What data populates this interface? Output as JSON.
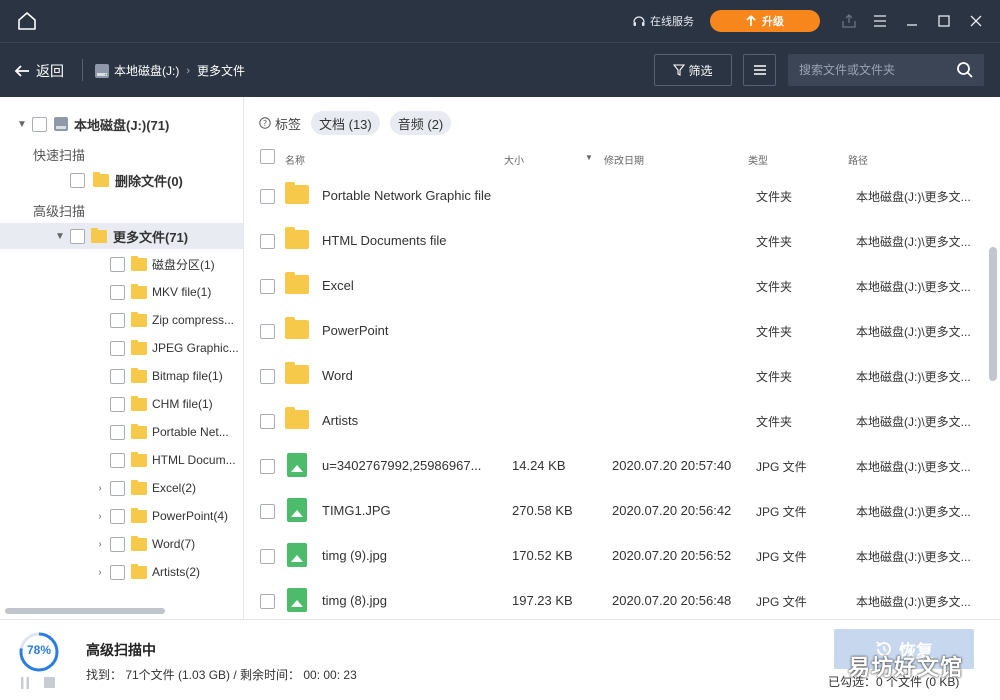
{
  "titlebar": {
    "service_label": "在线服务",
    "upgrade_label": "升级"
  },
  "toolbar": {
    "back_label": "返回",
    "breadcrumb": [
      "本地磁盘(J:)",
      "更多文件"
    ],
    "filter_label": "筛选",
    "search_placeholder": "搜索文件或文件夹"
  },
  "sidebar": {
    "root_label": "本地磁盘(J:)(71)",
    "quick_scan_label": "快速扫描",
    "deleted_files_label": "删除文件(0)",
    "advanced_scan_label": "高级扫描",
    "more_files_label": "更多文件(71)",
    "children": [
      {
        "label": "磁盘分区(1)",
        "expandable": false
      },
      {
        "label": "MKV file(1)",
        "expandable": false
      },
      {
        "label": "Zip compress...",
        "expandable": false
      },
      {
        "label": "JPEG Graphic...",
        "expandable": false
      },
      {
        "label": "Bitmap file(1)",
        "expandable": false
      },
      {
        "label": "CHM file(1)",
        "expandable": false
      },
      {
        "label": "Portable Net...",
        "expandable": false
      },
      {
        "label": "HTML Docum...",
        "expandable": false
      },
      {
        "label": "Excel(2)",
        "expandable": true
      },
      {
        "label": "PowerPoint(4)",
        "expandable": true
      },
      {
        "label": "Word(7)",
        "expandable": true
      },
      {
        "label": "Artists(2)",
        "expandable": true
      }
    ]
  },
  "filters": {
    "tags_label": "标签",
    "chips": [
      "文档 (13)",
      "音频 (2)"
    ]
  },
  "table": {
    "headers": {
      "name": "名称",
      "size": "大小",
      "date": "修改日期",
      "type": "类型",
      "path": "路径"
    },
    "rows": [
      {
        "icon": "folder-icon",
        "name": "Portable Network Graphic file",
        "size": "",
        "date": "",
        "type": "文件夹",
        "path": "本地磁盘(J:)\\更多文..."
      },
      {
        "icon": "folder-icon",
        "name": "HTML Documents file",
        "size": "",
        "date": "",
        "type": "文件夹",
        "path": "本地磁盘(J:)\\更多文..."
      },
      {
        "icon": "folder-icon",
        "name": "Excel",
        "size": "",
        "date": "",
        "type": "文件夹",
        "path": "本地磁盘(J:)\\更多文..."
      },
      {
        "icon": "folder-icon",
        "name": "PowerPoint",
        "size": "",
        "date": "",
        "type": "文件夹",
        "path": "本地磁盘(J:)\\更多文..."
      },
      {
        "icon": "folder-icon",
        "name": "Word",
        "size": "",
        "date": "",
        "type": "文件夹",
        "path": "本地磁盘(J:)\\更多文..."
      },
      {
        "icon": "folder-icon",
        "name": "Artists",
        "size": "",
        "date": "",
        "type": "文件夹",
        "path": "本地磁盘(J:)\\更多文..."
      },
      {
        "icon": "image-file-icon",
        "name": "u=3402767992,25986967...",
        "size": "14.24 KB",
        "date": "2020.07.20 20:57:40",
        "type": "JPG 文件",
        "path": "本地磁盘(J:)\\更多文..."
      },
      {
        "icon": "image-file-icon",
        "name": "TIMG1.JPG",
        "size": "270.58 KB",
        "date": "2020.07.20 20:56:42",
        "type": "JPG 文件",
        "path": "本地磁盘(J:)\\更多文..."
      },
      {
        "icon": "image-file-icon",
        "name": "timg (9).jpg",
        "size": "170.52 KB",
        "date": "2020.07.20 20:56:52",
        "type": "JPG 文件",
        "path": "本地磁盘(J:)\\更多文..."
      },
      {
        "icon": "image-file-icon",
        "name": "timg (8).jpg",
        "size": "197.23 KB",
        "date": "2020.07.20 20:56:48",
        "type": "JPG 文件",
        "path": "本地磁盘(J:)\\更多文..."
      }
    ]
  },
  "footer": {
    "progress_label": "78%",
    "progress": 0.78,
    "scan_title": "高级扫描中",
    "found_text": "找到： 71个文件 (1.03 GB) / 剩余时间： 00: 00: 23",
    "recover_label": "恢复",
    "selected_text": "已勾选：0 个文件 (0 KB)",
    "watermark": "易坊好文馆"
  },
  "colors": {
    "header_bg": "#2b3442",
    "accent_orange": "#f7861c",
    "progress_blue": "#2b7de1",
    "folder_yellow": "#f7c94b",
    "image_green": "#4cbb6c"
  }
}
